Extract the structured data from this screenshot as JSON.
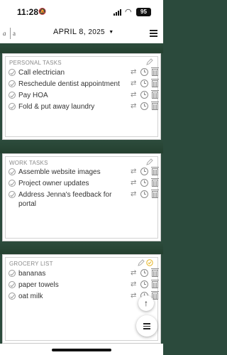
{
  "status": {
    "time": "11:28",
    "battery": "95"
  },
  "header": {
    "logo_left": "a",
    "logo_right": "a",
    "date": "APRIL 8,",
    "year": "2025"
  },
  "lists": [
    {
      "title": "PERSONAL TASKS",
      "items": [
        "Call electrician",
        "Reschedule dentist appointment",
        "Pay HOA",
        "Fold & put away laundry"
      ]
    },
    {
      "title": "WORK TASKS",
      "items": [
        "Assemble website images",
        "Project owner updates",
        "Address Jenna's feedback for portal"
      ]
    },
    {
      "title": "GROCERY LIST",
      "items": [
        "bananas",
        "paper towels",
        "oat milk"
      ]
    }
  ],
  "colors": {
    "background": "#2b4a3c",
    "card": "#ffffff",
    "accent": "#e6b422"
  },
  "icons": [
    "bell-silent-icon",
    "signal-icon",
    "wifi-icon",
    "battery-icon",
    "menu-icon",
    "chevron-down-icon",
    "edit-pencil-icon",
    "check-circle-icon",
    "repeat-icon",
    "clock-icon",
    "trash-icon",
    "arrow-up-icon"
  ]
}
